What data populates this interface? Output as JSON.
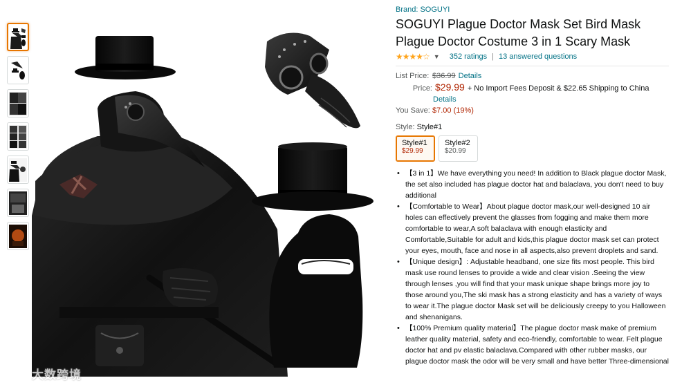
{
  "brand": "Brand: SOGUYI",
  "title": "SOGUYI Plague Doctor Mask Set Bird Mask Plague Doctor Costume 3 in 1 Scary Mask",
  "rating": {
    "stars": "★★★★☆",
    "stars_value": 4.5,
    "ratings_count": "352 ratings",
    "separator": "|",
    "answered": "13 answered questions"
  },
  "price": {
    "list_label": "List Price:",
    "list_price": "$36.99",
    "details_link": "Details",
    "price_label": "Price:",
    "price": "$29.99",
    "shipping_note": "+ No Import Fees Deposit & $22.65 Shipping to China",
    "details_link2": "Details",
    "save_label": "You Save:",
    "save_value": "$7.00 (19%)"
  },
  "style": {
    "label": "Style:",
    "selected": "Style#1",
    "options": [
      {
        "name": "Style#1",
        "price": "$29.99"
      },
      {
        "name": "Style#2",
        "price": "$20.99"
      }
    ]
  },
  "bullets": [
    "【3 in 1】We have everything you need! In addition to Black plague doctor Mask, the set also included has plague doctor hat and balaclava, you don't need to buy additional",
    "【Comfortable to Wear】About plague doctor mask,our well-designed 10 air holes can effectively prevent the glasses from fogging and make them more comfortable to wear,A soft balaclava with enough elasticity and Comfortable,Suitable for adult and kids,this plague doctor mask set can protect your eyes, mouth, face and nose in all aspects,also prevent droplets and sand.",
    "【Unique design】: Adjustable headband, one size fits most people. This bird mask use round lenses to provide a wide and clear vision .Seeing the view through lenses ,you will find that your mask unique shape brings more joy to those around you,The ski mask has a strong elasticity and has a variety of ways to wear it.The plague doctor Mask set will be deliciously creepy to you Halloween and shenanigans.",
    "【100% Premium quality material】The plague doctor mask make of premium leather quality material, safety and eco-friendly, comfortable to wear. Felt plague doctor hat and pv elastic balaclava.Compared with other rubber masks, our plague doctor mask the odor will be very small and have better Three-dimensional"
  ],
  "watermark": "大数跨境",
  "colors": {
    "link": "#007185",
    "price": "#b12704",
    "star": "#ffa41c",
    "selected_border": "#e77600"
  }
}
